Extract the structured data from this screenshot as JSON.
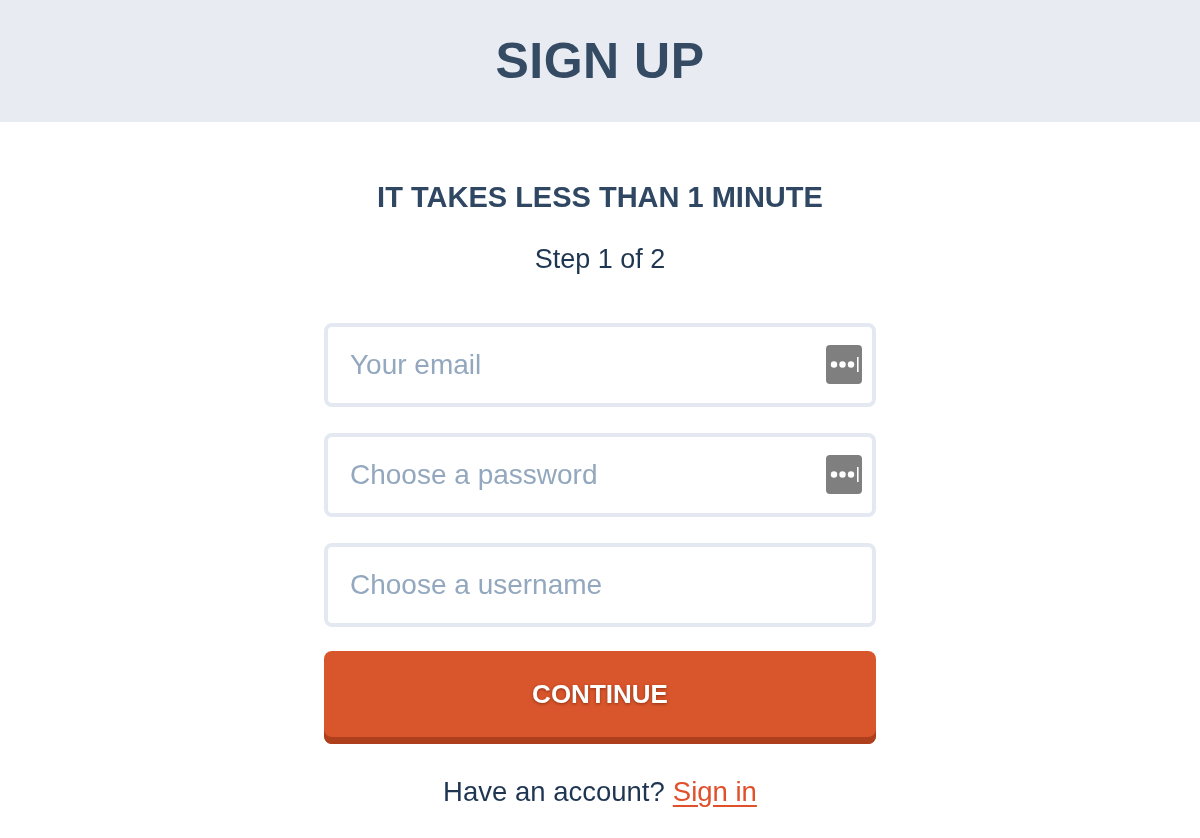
{
  "header": {
    "title": "SIGN UP"
  },
  "form": {
    "subtitle": "IT TAKES LESS THAN 1 MINUTE",
    "step": "Step 1 of 2",
    "fields": [
      {
        "placeholder": "Your email",
        "autofill_icon": true
      },
      {
        "placeholder": "Choose a password",
        "autofill_icon": true
      },
      {
        "placeholder": "Choose a username",
        "autofill_icon": false
      }
    ],
    "submit": {
      "label": "CONTINUE"
    },
    "footer": {
      "text": "Have an account?",
      "link": "Sign in"
    }
  }
}
